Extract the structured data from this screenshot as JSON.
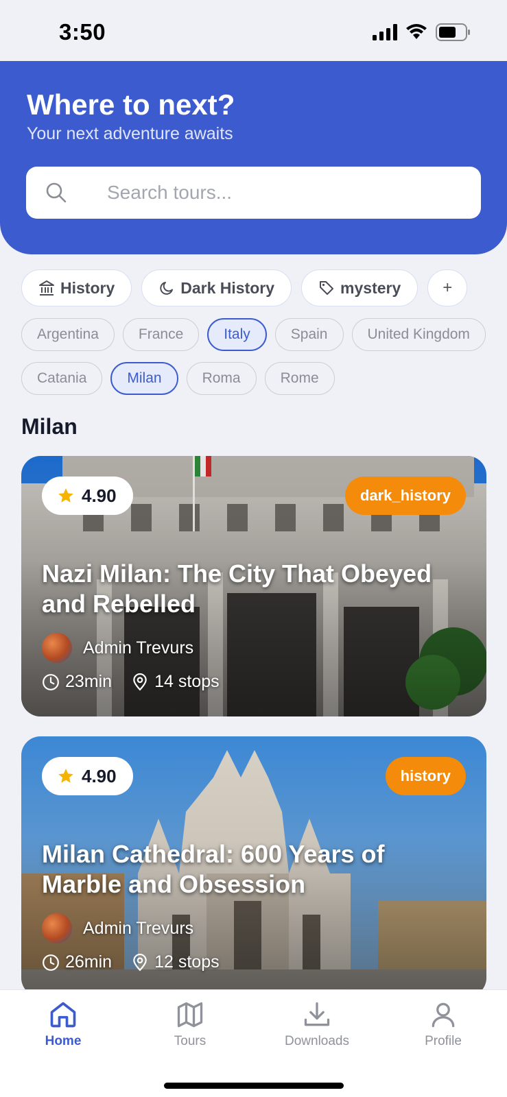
{
  "status_bar": {
    "time": "3:50"
  },
  "header": {
    "title": "Where to next?",
    "subtitle": "Your next adventure awaits",
    "search_placeholder": "Search tours..."
  },
  "categories": [
    {
      "label": "History",
      "icon": "museum-icon"
    },
    {
      "label": "Dark History",
      "icon": "moon-icon"
    },
    {
      "label": "mystery",
      "icon": "tag-icon"
    },
    {
      "label": "+",
      "icon": "plus-icon"
    }
  ],
  "countries": [
    {
      "label": "Argentina",
      "active": false
    },
    {
      "label": "France",
      "active": false
    },
    {
      "label": "Italy",
      "active": true
    },
    {
      "label": "Spain",
      "active": false
    },
    {
      "label": "United Kingdom",
      "active": false
    }
  ],
  "cities": [
    {
      "label": "Catania",
      "active": false
    },
    {
      "label": "Milan",
      "active": true
    },
    {
      "label": "Roma",
      "active": false
    },
    {
      "label": "Rome",
      "active": false
    }
  ],
  "section_title": "Milan",
  "tours": [
    {
      "rating": "4.90",
      "tag": "dark_history",
      "title": "Nazi Milan: The City That Obeyed and Rebelled",
      "author": "Admin Trevurs",
      "duration": "23min",
      "stops": "14 stops"
    },
    {
      "rating": "4.90",
      "tag": "history",
      "title": "Milan Cathedral: 600 Years of Marble and Obsession",
      "author": "Admin Trevurs",
      "duration": "26min",
      "stops": "12 stops"
    }
  ],
  "tabbar": [
    {
      "label": "Home",
      "icon": "home-icon",
      "active": true
    },
    {
      "label": "Tours",
      "icon": "map-icon",
      "active": false
    },
    {
      "label": "Downloads",
      "icon": "download-icon",
      "active": false
    },
    {
      "label": "Profile",
      "icon": "profile-icon",
      "active": false
    }
  ],
  "colors": {
    "accent": "#3c5bce",
    "tag": "#f58b0a",
    "background": "#eff1f7",
    "star": "#f6b400"
  }
}
